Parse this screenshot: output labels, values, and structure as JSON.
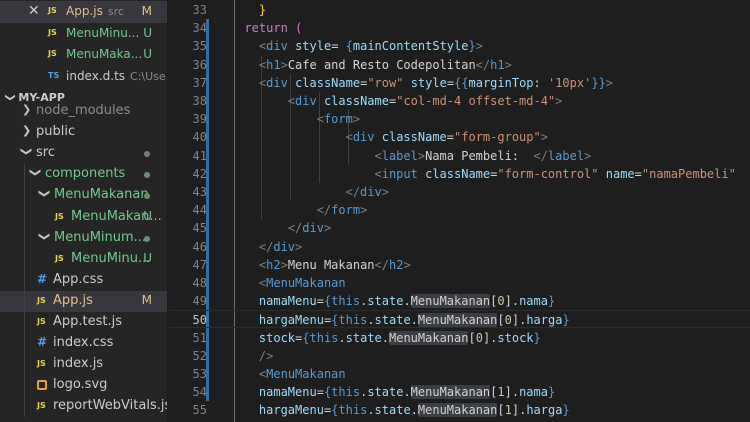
{
  "open_editors": [
    {
      "name": "App.js",
      "desc": "src",
      "status": "M",
      "badge": "JS",
      "active": true,
      "state": "mod"
    },
    {
      "name": "MenuMinu...",
      "desc": "",
      "status": "U",
      "badge": "JS",
      "active": false,
      "state": "new"
    },
    {
      "name": "MenuMaka...",
      "desc": "",
      "status": "U",
      "badge": "JS",
      "active": false,
      "state": "new"
    },
    {
      "name": "index.d.ts",
      "desc": "C:\\Use...",
      "status": "",
      "badge": "TS",
      "active": false,
      "state": "plain"
    }
  ],
  "explorer": {
    "section_title": "MY-APP",
    "items": [
      {
        "label": "node_modules",
        "type": "folder",
        "open": false,
        "style": "dim"
      },
      {
        "label": "public",
        "type": "folder",
        "open": false,
        "style": "plain"
      },
      {
        "label": "src",
        "type": "folder",
        "open": true,
        "style": "plain",
        "dot": true
      },
      {
        "label": "components",
        "type": "folder",
        "open": true,
        "style": "green",
        "dot": true
      },
      {
        "label": "MenuMakanan",
        "type": "folder",
        "open": true,
        "style": "green",
        "dot": true
      },
      {
        "label": "MenuMakan...",
        "type": "js",
        "status": "U",
        "style": "green"
      },
      {
        "label": "MenuMinum...",
        "type": "folder",
        "open": true,
        "style": "green",
        "dot": true
      },
      {
        "label": "MenuMinu...",
        "type": "js",
        "status": "U",
        "style": "green"
      },
      {
        "label": "App.css",
        "type": "css",
        "style": "plain"
      },
      {
        "label": "App.js",
        "type": "js",
        "status": "M",
        "style": "mod",
        "active": true
      },
      {
        "label": "App.test.js",
        "type": "js",
        "style": "plain"
      },
      {
        "label": "index.css",
        "type": "css",
        "style": "plain"
      },
      {
        "label": "index.js",
        "type": "js",
        "style": "plain"
      },
      {
        "label": "logo.svg",
        "type": "svg",
        "style": "plain"
      },
      {
        "label": "reportWebVitals.js",
        "type": "js",
        "style": "plain"
      }
    ]
  },
  "editor": {
    "current_line": 50,
    "lines": [
      {
        "n": 33,
        "tokens": [
          [
            "    }",
            "gold"
          ]
        ]
      },
      {
        "n": 34,
        "tokens": [
          [
            "  ",
            "txt"
          ],
          [
            "return",
            "kw"
          ],
          [
            " (",
            "pink"
          ]
        ]
      },
      {
        "n": 35,
        "tokens": [
          [
            "    ",
            "txt"
          ],
          [
            "<",
            "brk"
          ],
          [
            "div",
            "tag"
          ],
          [
            " ",
            "txt"
          ],
          [
            "style",
            "attr"
          ],
          [
            "= ",
            "txt"
          ],
          [
            "{",
            "tag"
          ],
          [
            "mainContentStyle",
            "attr"
          ],
          [
            "}",
            "tag"
          ],
          [
            ">",
            "brk"
          ]
        ]
      },
      {
        "n": 36,
        "tokens": [
          [
            "    ",
            "txt"
          ],
          [
            "<",
            "brk"
          ],
          [
            "h1",
            "tag"
          ],
          [
            ">",
            "brk"
          ],
          [
            "Cafe and Resto Codepolitan",
            "txt"
          ],
          [
            "</",
            "brk"
          ],
          [
            "h1",
            "tag"
          ],
          [
            ">",
            "brk"
          ]
        ]
      },
      {
        "n": 37,
        "tokens": [
          [
            "    ",
            "txt"
          ],
          [
            "<",
            "brk"
          ],
          [
            "div",
            "tag"
          ],
          [
            " ",
            "txt"
          ],
          [
            "className",
            "attr"
          ],
          [
            "=",
            "txt"
          ],
          [
            "\"row\"",
            "str"
          ],
          [
            " ",
            "txt"
          ],
          [
            "style",
            "attr"
          ],
          [
            "=",
            "txt"
          ],
          [
            "{{",
            "tag"
          ],
          [
            "marginTop",
            "attr"
          ],
          [
            ": ",
            "txt"
          ],
          [
            "'10px'",
            "str"
          ],
          [
            "}}",
            "tag"
          ],
          [
            ">",
            "brk"
          ]
        ]
      },
      {
        "n": 38,
        "tokens": [
          [
            "        ",
            "txt"
          ],
          [
            "<",
            "brk"
          ],
          [
            "div",
            "tag"
          ],
          [
            " ",
            "txt"
          ],
          [
            "className",
            "attr"
          ],
          [
            "=",
            "txt"
          ],
          [
            "\"col-md-4 offset-md-4\"",
            "str"
          ],
          [
            ">",
            "brk"
          ]
        ]
      },
      {
        "n": 39,
        "tokens": [
          [
            "            ",
            "txt"
          ],
          [
            "<",
            "brk"
          ],
          [
            "form",
            "tag"
          ],
          [
            ">",
            "brk"
          ]
        ]
      },
      {
        "n": 40,
        "tokens": [
          [
            "                ",
            "txt"
          ],
          [
            "<",
            "brk"
          ],
          [
            "div",
            "tag"
          ],
          [
            " ",
            "txt"
          ],
          [
            "className",
            "attr"
          ],
          [
            "=",
            "txt"
          ],
          [
            "\"form-group\"",
            "str"
          ],
          [
            ">",
            "brk"
          ]
        ]
      },
      {
        "n": 41,
        "tokens": [
          [
            "                    ",
            "txt"
          ],
          [
            "<",
            "brk"
          ],
          [
            "label",
            "tag"
          ],
          [
            ">",
            "brk"
          ],
          [
            "Nama Pembeli:  ",
            "txt"
          ],
          [
            "</",
            "brk"
          ],
          [
            "label",
            "tag"
          ],
          [
            ">",
            "brk"
          ]
        ]
      },
      {
        "n": 42,
        "tokens": [
          [
            "                    ",
            "txt"
          ],
          [
            "<",
            "brk"
          ],
          [
            "input",
            "tag"
          ],
          [
            " ",
            "txt"
          ],
          [
            "className",
            "attr"
          ],
          [
            "=",
            "txt"
          ],
          [
            "\"form-control\"",
            "str"
          ],
          [
            " ",
            "txt"
          ],
          [
            "name",
            "attr"
          ],
          [
            "=",
            "txt"
          ],
          [
            "\"namaPembeli\"",
            "str"
          ]
        ]
      },
      {
        "n": 43,
        "tokens": [
          [
            "                ",
            "txt"
          ],
          [
            "</",
            "brk"
          ],
          [
            "div",
            "tag"
          ],
          [
            ">",
            "brk"
          ]
        ]
      },
      {
        "n": 44,
        "tokens": [
          [
            "            ",
            "txt"
          ],
          [
            "</",
            "brk"
          ],
          [
            "form",
            "tag"
          ],
          [
            ">",
            "brk"
          ]
        ]
      },
      {
        "n": 45,
        "tokens": [
          [
            "        ",
            "txt"
          ],
          [
            "</",
            "brk"
          ],
          [
            "div",
            "tag"
          ],
          [
            ">",
            "brk"
          ]
        ]
      },
      {
        "n": 46,
        "tokens": [
          [
            "    ",
            "txt"
          ],
          [
            "</",
            "brk"
          ],
          [
            "div",
            "tag"
          ],
          [
            ">",
            "brk"
          ]
        ]
      },
      {
        "n": 47,
        "tokens": [
          [
            "    ",
            "txt"
          ],
          [
            "<",
            "brk"
          ],
          [
            "h2",
            "tag"
          ],
          [
            ">",
            "brk"
          ],
          [
            "Menu Makanan",
            "txt"
          ],
          [
            "</",
            "brk"
          ],
          [
            "h2",
            "tag"
          ],
          [
            ">",
            "brk"
          ]
        ]
      },
      {
        "n": 48,
        "tokens": [
          [
            "    ",
            "txt"
          ],
          [
            "<",
            "brk"
          ],
          [
            "MenuMakanan",
            "tag"
          ]
        ]
      },
      {
        "n": 49,
        "tokens": [
          [
            "    ",
            "txt"
          ],
          [
            "namaMenu",
            "attr"
          ],
          [
            "=",
            "txt"
          ],
          [
            "{",
            "tag"
          ],
          [
            "this",
            "this"
          ],
          [
            ".",
            "txt"
          ],
          [
            "state",
            "attr"
          ],
          [
            ".",
            "txt"
          ],
          [
            "MenuMakanan",
            "hl"
          ],
          [
            "[",
            "txt"
          ],
          [
            "0",
            "num"
          ],
          [
            "].",
            "txt"
          ],
          [
            "nama",
            "attr"
          ],
          [
            "}",
            "tag"
          ]
        ]
      },
      {
        "n": 50,
        "tokens": [
          [
            "    ",
            "txt"
          ],
          [
            "hargaMenu",
            "attr"
          ],
          [
            "=",
            "txt"
          ],
          [
            "{",
            "tag"
          ],
          [
            "this",
            "this"
          ],
          [
            ".",
            "txt"
          ],
          [
            "state",
            "attr"
          ],
          [
            ".",
            "txt"
          ],
          [
            "MenuMakanan",
            "hl"
          ],
          [
            "[",
            "txt"
          ],
          [
            "0",
            "num"
          ],
          [
            "].",
            "txt"
          ],
          [
            "harga",
            "attr"
          ],
          [
            "}",
            "tag"
          ]
        ]
      },
      {
        "n": 51,
        "tokens": [
          [
            "    ",
            "txt"
          ],
          [
            "stock",
            "attr"
          ],
          [
            "=",
            "txt"
          ],
          [
            "{",
            "tag"
          ],
          [
            "this",
            "this"
          ],
          [
            ".",
            "txt"
          ],
          [
            "state",
            "attr"
          ],
          [
            ".",
            "txt"
          ],
          [
            "MenuMakanan",
            "hl"
          ],
          [
            "[",
            "txt"
          ],
          [
            "0",
            "num"
          ],
          [
            "].",
            "txt"
          ],
          [
            "stock",
            "attr"
          ],
          [
            "}",
            "tag"
          ]
        ]
      },
      {
        "n": 52,
        "tokens": [
          [
            "    ",
            "txt"
          ],
          [
            "/>",
            "brk"
          ]
        ]
      },
      {
        "n": 53,
        "tokens": [
          [
            "    ",
            "txt"
          ],
          [
            "<",
            "brk"
          ],
          [
            "MenuMakanan",
            "tag"
          ]
        ]
      },
      {
        "n": 54,
        "tokens": [
          [
            "    ",
            "txt"
          ],
          [
            "namaMenu",
            "attr"
          ],
          [
            "=",
            "txt"
          ],
          [
            "{",
            "tag"
          ],
          [
            "this",
            "this"
          ],
          [
            ".",
            "txt"
          ],
          [
            "state",
            "attr"
          ],
          [
            ".",
            "txt"
          ],
          [
            "MenuMakanan",
            "hl"
          ],
          [
            "[",
            "txt"
          ],
          [
            "1",
            "num"
          ],
          [
            "].",
            "txt"
          ],
          [
            "nama",
            "attr"
          ],
          [
            "}",
            "tag"
          ]
        ]
      },
      {
        "n": 55,
        "tokens": [
          [
            "    ",
            "txt"
          ],
          [
            "hargaMenu",
            "attr"
          ],
          [
            "=",
            "txt"
          ],
          [
            "{",
            "tag"
          ],
          [
            "this",
            "this"
          ],
          [
            ".",
            "txt"
          ],
          [
            "state",
            "attr"
          ],
          [
            ".",
            "txt"
          ],
          [
            "MenuMakanan",
            "hl"
          ],
          [
            "[",
            "txt"
          ],
          [
            "1",
            "num"
          ],
          [
            "].",
            "txt"
          ],
          [
            "harga",
            "attr"
          ],
          [
            "}",
            "tag"
          ]
        ]
      }
    ]
  }
}
